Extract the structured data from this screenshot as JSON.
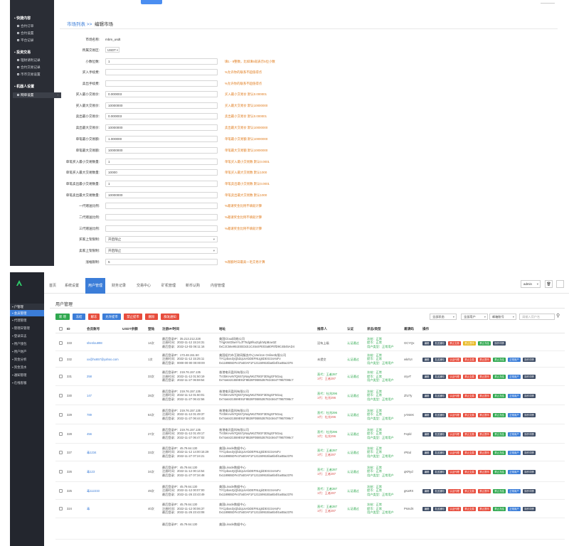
{
  "top": {
    "sidebar": {
      "groups": [
        {
          "label": "快捷内容",
          "items": [
            "合约订单",
            "合约设置",
            "平台记录"
          ]
        },
        {
          "label": "投资交易",
          "items": [
            "理财请利记录",
            "合约交易记录",
            "币币交易设置"
          ]
        },
        {
          "label": "机器人设置",
          "items": [
            "网单设置"
          ]
        }
      ]
    },
    "breadcrumb": {
      "parent": "市场列表 >>",
      "current": "编辑市场"
    },
    "form": {
      "fields": [
        {
          "label": "市场名称:",
          "type": "static",
          "value": "mbm_usdt",
          "hint": ""
        },
        {
          "label": "所属交易区:",
          "type": "smallselect",
          "value": "USDT",
          "hint": ""
        },
        {
          "label": "小数位数:",
          "type": "input",
          "value": "1",
          "hint": "填1 - 8整数，比如填5就表示5位小数"
        },
        {
          "label": "买入手续费:",
          "type": "input",
          "value": "",
          "hint": "%允许你的联系不超值得点"
        },
        {
          "label": "卖出手续费:",
          "type": "input",
          "value": "",
          "hint": "%允许你的联系不超值得点"
        },
        {
          "label": "买入最小交易价:",
          "type": "input",
          "value": "0.000003",
          "hint": "买入最小交易价 默认0.000001"
        },
        {
          "label": "买入最大交易价:",
          "type": "input",
          "value": "10000000",
          "hint": "买入最大交易价 默认10000000"
        },
        {
          "label": "卖出最小交易价:",
          "type": "input",
          "value": "0.000003",
          "hint": "卖出最小交易价 默认0.000001"
        },
        {
          "label": "卖出最大交易价:",
          "type": "input",
          "value": "10000000",
          "hint": "卖出最大交易价 默认10000000"
        },
        {
          "label": "单笔最小交易额:",
          "type": "input",
          "value": "1.000000",
          "hint": "单笔最小交易额 默认10000000"
        },
        {
          "label": "单笔最大交易额:",
          "type": "input",
          "value": "10000000",
          "hint": "单笔最大交易额 默认10000000"
        },
        {
          "label": "单笔买入最小交易数量:",
          "type": "input",
          "value": "1",
          "hint": "单笔买入最小交易数 默认0.0001"
        },
        {
          "label": "单笔买入最大交易数量:",
          "type": "input",
          "value": "10000",
          "hint": "单笔买入最大交易数 默认1000"
        },
        {
          "label": "单笔卖出最小交易数量:",
          "type": "input",
          "value": "1",
          "hint": "单笔卖出最小交易数 默认0.0001"
        },
        {
          "label": "单笔卖出最大交易数量:",
          "type": "input",
          "value": "10000000",
          "hint": "单笔卖出最大交易数 默认1000"
        },
        {
          "label": "一代赠送比例:",
          "type": "input",
          "value": "",
          "hint": "%邀请奖金比例不填就计算"
        },
        {
          "label": "二代赠送比例:",
          "type": "input",
          "value": "",
          "hint": "%邀请奖金比例不填就计算"
        },
        {
          "label": "三代赠送比例:",
          "type": "input",
          "value": "",
          "hint": "%邀请奖金比例不填就计算"
        },
        {
          "label": "买家上架限制:",
          "type": "select",
          "value": "开启限止",
          "hint": ""
        },
        {
          "label": "卖家上架限制:",
          "type": "select",
          "value": "开启限止",
          "hint": ""
        },
        {
          "label": "涨幅限制:",
          "type": "input",
          "value": "5",
          "hint": "%限额时日最高一毛交易计算"
        }
      ]
    }
  },
  "bottom": {
    "sidebar": {
      "items": [
        {
          "label": "户管理",
          "state": "head"
        },
        {
          "label": "会员管理",
          "state": "active"
        },
        {
          "label": "代理管理",
          "state": ""
        },
        {
          "label": "管理日管理",
          "state": ""
        },
        {
          "label": "登录日志",
          "state": ""
        },
        {
          "label": "用户钱包",
          "state": ""
        },
        {
          "label": "用户财产",
          "state": ""
        },
        {
          "label": "资金分析",
          "state": ""
        },
        {
          "label": "资金流水",
          "state": ""
        },
        {
          "label": "通知管理",
          "state": ""
        },
        {
          "label": "在线客服",
          "state": ""
        }
      ]
    },
    "tabs": [
      "首页",
      "系统设置",
      "用户管理",
      "财务记录",
      "交易中心",
      "矿机管理",
      "新币认购",
      "内容管理"
    ],
    "active_tab_index": 2,
    "admin_label": "admin",
    "page_title": "用户管理",
    "toolbar": {
      "buttons": [
        {
          "label": "新 增",
          "color": "#2fa84f"
        },
        {
          "label": "冻结",
          "color": "#3b7dd8"
        },
        {
          "label": "解冻",
          "color": "#e74c3c"
        },
        {
          "label": "允许提币",
          "color": "#3b7dd8"
        },
        {
          "label": "禁止提币",
          "color": "#e74c3c"
        },
        {
          "label": "删除",
          "color": "#e74c3c"
        },
        {
          "label": "群发通知",
          "color": "#e74c3c"
        }
      ],
      "filters": [
        "全部状态",
        "全部用户",
        "邮箱账号"
      ],
      "search_placeholder": "请输入用户名"
    },
    "table": {
      "headers": [
        "ID",
        "会员账号",
        "USDT余额",
        "登陆",
        "注册IP/时间",
        "地址",
        "推荐人",
        "认证",
        "状态/类型",
        "邀请码",
        "操作"
      ],
      "rows": [
        {
          "id": "333",
          "account": "shenlou998",
          "login": "14次",
          "reg": [
            "最后登录IP：35.213.212.228",
            "注册时间：2022-11-12 15:24:31",
            "最后登录：2022-12-03 06:11:16"
          ],
          "addr": [
            "美国Cloud网络公司",
            "TYqjKIsIDbwrYLdTTsdg9fsuZqdcWpBow3Z",
            "0xC2C56e951EEE3dc1C4544FE03a80F0fD9C4B45AD4"
          ],
          "ref": "没有上级",
          "auth": "认证通过",
          "status": [
            "冻结：正常",
            "提币：正常",
            "用户类型：正常用户"
          ],
          "invite": "GCYQx",
          "variant": "a"
        },
        {
          "id": "332",
          "account": "xx@hx657@yahoo.com",
          "login": "1次",
          "reg": [
            "最后登录IP：173.48.151.50",
            "注册时间：2022-11-12 15:25:11",
            "最后登录：0000-00-00 00:00:00"
          ],
          "addr": [
            "美国纽约市互联网服务中心Verizon Online有限公司",
            "TYCpbxeZyQbZqUxAbDEFNUgkDEXz2xHxFv",
            "0x1189B5DFe37aE0AF1F121159915ba6b4f4a4Ba2376"
          ],
          "ref": "未提交",
          "auth": "认证通过",
          "status": [
            "冻结：正常",
            "提币：正常",
            "用户类型：正常用户"
          ],
          "invite": "wkrlUI",
          "variant": "b"
        },
        {
          "id": "331",
          "account": "258",
          "login": "33次",
          "reg": [
            "最后登录IP：219.76.157.135",
            "注册时间：2022-11-12 01:50:19",
            "最后登录：2022-11-27 06:59:54"
          ],
          "addr": [
            "香港电讯盈科有限公司",
            "TV3bKAeN7Q6S7yNayNKZ7BGF3D5gGF5Gaq",
            "0x74a6421559E91F8B28F0B852B782c564779B7096c7"
          ],
          "ref": "直代：王者287",
          "ref2": "1代：王者287",
          "auth": "认证通过",
          "status": [
            "冻结：正常",
            "提币：正常",
            "用户类型：正常用户"
          ],
          "invite": "oIyvT",
          "variant": "b"
        },
        {
          "id": "330",
          "account": "147",
          "login": "28次",
          "reg": [
            "最后登录IP：219.76.157.135",
            "注册时间：2022-11-12 01:50:01",
            "最后登录：2022-11-27 06:42:56"
          ],
          "addr": [
            "香港电讯盈科有限公司",
            "TV3bKAeN7Q6S7yNayNKZ7BGF3D5gGF5Gaq",
            "0x74a6421559E91F8B28F0B852B782c564779B7096c7"
          ],
          "ref": "直代：杜兆296",
          "ref2": "1代：杜兆296",
          "auth": "认证通过",
          "status": [
            "冻结：正常",
            "提币：正常",
            "用户类型：正常用户"
          ],
          "invite": "ZhzTy",
          "variant": "b"
        },
        {
          "id": "329",
          "account": "789",
          "login": "64次",
          "reg": [
            "最后登录IP：219.76.157.135",
            "注册时间：2022-11-12 01:49:37",
            "最后登录：2022-11-27 06:44:43"
          ],
          "addr": [
            "香港电讯盈科有限公司",
            "TV3bKAeN7Q6S7yNayNKZ7BGF3D5gGF5Gaq",
            "0x74a6421559E91F8B28F0B852B782c564779B7096c7"
          ],
          "ref": "直代：杜兆296",
          "ref2": "1代：杜兆296",
          "auth": "认证通过",
          "status": [
            "冻结：正常",
            "提币：正常",
            "用户类型：正常用户"
          ],
          "invite": "yANmK",
          "variant": "b"
        },
        {
          "id": "328",
          "account": "456",
          "login": "27次",
          "reg": [
            "最后登录IP：219.76.157.135",
            "注册时间：2022-11-12 01:49:17",
            "最后登录：2022-11-27 06:47:02"
          ],
          "addr": [
            "香港电讯盈科有限公司",
            "TV3bKAeN7Q6S7yNayNKZ7BGF3D5gGF5Gaq",
            "0x74a6421559E91F8B28F0B852B782c564779B7096c7"
          ],
          "ref": "直代：杜兆296",
          "ref2": "1代：杜兆296",
          "auth": "认证通过",
          "status": [
            "冻结：正常",
            "提币：正常",
            "用户类型：正常用户"
          ],
          "invite": "Fepld",
          "variant": "b"
        },
        {
          "id": "327",
          "account": "毒1234",
          "login": "33次",
          "reg": [
            "最后登录IP：45.79.64.130",
            "注册时间：2022-11-12 14:00:15:29",
            "最后登录：2022-11-27 07:24:21"
          ],
          "addr": [
            "美国Linode数据中心",
            "TYCpbxeZyQbZqUxAbDEFNUgkDEXz2xHxFv",
            "0x1189B5DFe37aE0AF1F121159915ba6b4f4a4Ba2376"
          ],
          "ref": "直代：王者287",
          "ref2": "1代：王者287",
          "auth": "认证通过",
          "status": [
            "冻结：正常",
            "提币：正常",
            "用户类型：正常用户"
          ],
          "invite": "rPEul",
          "variant": "b"
        },
        {
          "id": "326",
          "account": "毒123",
          "login": "34次",
          "reg": [
            "最后登录IP：45.79.64.130",
            "注册时间：2022-11-12 00:14:54",
            "最后登录：2022-11-27 07:34:48"
          ],
          "addr": [
            "美国Linode数据中心",
            "TYCpbxeZyQbZqUxAbDEFNUgkDEXz2xHxFv",
            "0x1189B5DFe37aE0AF1F121159915ba6b4f4a4Ba2376"
          ],
          "ref": "直代：王者287",
          "ref2": "1代：王者287",
          "auth": "认证通过",
          "status": [
            "冻结：正常",
            "提币：正常",
            "用户类型：正常用户"
          ],
          "invite": "qKRyd",
          "variant": "b"
        },
        {
          "id": "325",
          "account": "毒112233",
          "login": "49次",
          "reg": [
            "最后登录IP：45.79.64.130",
            "注册时间：2022-11-12 00:07:00",
            "最后登录：2022-11-26 23:43:49"
          ],
          "addr": [
            "美国Linode数据中心",
            "TYCpbxeZyQbZqUxAbDEFNUgkDEXz2xHxFv",
            "0x1189B5DFe37aE0AF1F121159915ba6b4f4a4Ba2376"
          ],
          "ref": "直代：王者287",
          "ref2": "1代：王者287",
          "auth": "认证通过",
          "status": [
            "冻结：正常",
            "提币：正常",
            "用户类型：正常用户"
          ],
          "invite": "gKaRX",
          "variant": "b"
        },
        {
          "id": "324",
          "account": "毒",
          "login": "40次",
          "reg": [
            "最后登录IP：45.79.64.130",
            "注册时间：2022-11-12 00:06:37",
            "最后登录：2022-11-26 23:43:08"
          ],
          "addr": [
            "美国Linode数据中心",
            "TYCpbxeZyQbZqUxAbDEFNUgkDEXz2xHxFv",
            "0x1189B5DFe37aE0AF1F121159915ba6b4f4a4Ba2376"
          ],
          "ref": "直代：王者287",
          "ref2": "1代：王者287",
          "auth": "认证通过",
          "status": [
            "冻结：正常",
            "提币：正常",
            "用户类型：正常用户"
          ],
          "invite": "PsmdX",
          "variant": "b"
        },
        {
          "id": "",
          "account": "",
          "login": "",
          "reg": [
            "最后登录IP：45.79.64.130",
            "",
            ""
          ],
          "addr": [
            "美国Linode数据中心",
            "",
            ""
          ],
          "ref": "",
          "auth": "",
          "status": [
            "",
            "",
            ""
          ],
          "invite": "",
          "variant": "none"
        }
      ],
      "ops_a": [
        {
          "label": "编辑",
          "color": "#3c4b64"
        },
        {
          "label": "发送通知",
          "color": "#3c4b64"
        },
        {
          "label": "禁止交易",
          "color": "#e74c3c"
        },
        {
          "label": "禁止提币",
          "color": "#e8b923"
        },
        {
          "label": "禁止冻结",
          "color": "#2fa84f"
        },
        {
          "label": "操作详情",
          "color": "#3c4b64"
        }
      ],
      "ops_b": [
        {
          "label": "编辑",
          "color": "#3c4b64"
        },
        {
          "label": "发送通知",
          "color": "#3c4b64"
        },
        {
          "label": "认证代理",
          "color": "#e74c3c"
        },
        {
          "label": "禁止交易",
          "color": "#e74c3c"
        },
        {
          "label": "禁止提币",
          "color": "#e74c3c"
        },
        {
          "label": "禁止冻结",
          "color": "#2fa84f"
        },
        {
          "label": "正常用户",
          "color": "#3b7dd8"
        },
        {
          "label": "操作详情",
          "color": "#3c4b64"
        }
      ]
    }
  }
}
